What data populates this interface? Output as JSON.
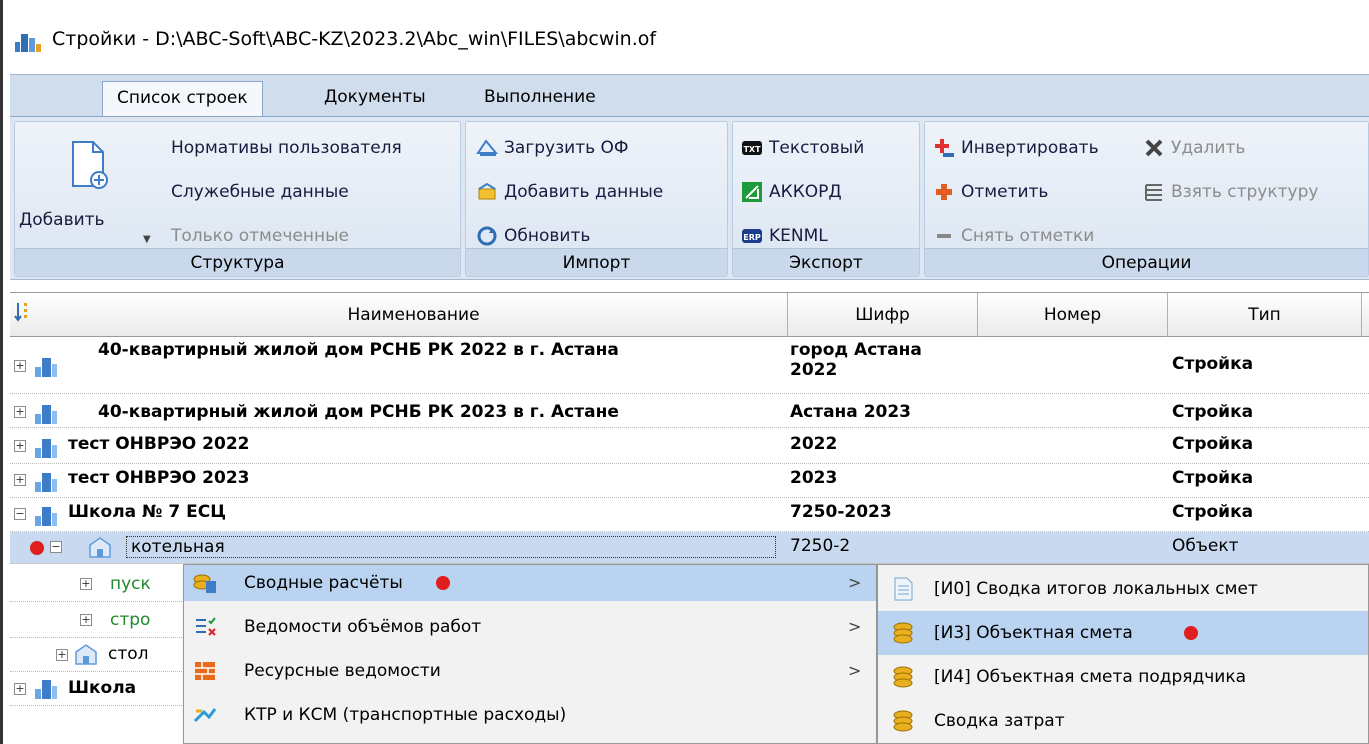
{
  "window": {
    "title": "Стройки - D:\\ABC-Soft\\ABC-KZ\\2023.2\\Abc_win\\FILES\\abcwin.of"
  },
  "ribbon": {
    "tabs": [
      {
        "label": "Список строек",
        "active": true
      },
      {
        "label": "Документы",
        "active": false
      },
      {
        "label": "Выполнение",
        "active": false
      }
    ],
    "groups": {
      "structure": {
        "label": "Структура",
        "add": "Добавить",
        "items": [
          "Нормативы пользователя",
          "Служебные данные",
          "Только отмеченные"
        ]
      },
      "import": {
        "label": "Импорт",
        "items": [
          "Загрузить ОФ",
          "Добавить данные",
          "Обновить"
        ]
      },
      "export": {
        "label": "Экспорт",
        "items": [
          "Текстовый",
          "АККОРД",
          "KENML"
        ]
      },
      "operations": {
        "label": "Операции",
        "items": [
          "Инвертировать",
          "Удалить",
          "Отметить",
          "Взять структуру",
          "Снять отметки"
        ]
      }
    }
  },
  "grid": {
    "columns": [
      "Наименование",
      "Шифр",
      "Номер",
      "Тип"
    ],
    "rows": [
      {
        "name": "40-квартирный жилой дом РСНБ РК 2022 в г. Астана",
        "code1": "город Астана",
        "code2": "2022",
        "type": "Стройка"
      },
      {
        "name": "40-квартирный жилой дом РСНБ РК 2023 в г. Астане",
        "code": "Астана 2023",
        "type": "Стройка"
      },
      {
        "name": "тест ОНВРЭО 2022",
        "code": "2022",
        "type": "Стройка"
      },
      {
        "name": "тест ОНВРЭО 2023",
        "code": "2023",
        "type": "Стройка"
      },
      {
        "name": "Школа № 7 ЕСЦ",
        "code": "7250-2023",
        "type": "Стройка"
      },
      {
        "name": "котельная",
        "code": "7250-2",
        "type": "Объект"
      },
      {
        "name": "пуск"
      },
      {
        "name": "стро"
      },
      {
        "name": "стол"
      },
      {
        "name": "Школа"
      }
    ]
  },
  "context_menu": {
    "items": [
      {
        "label": "Сводные расчёты",
        "submenu": true
      },
      {
        "label": "Ведомости объёмов работ",
        "submenu": true
      },
      {
        "label": "Ресурсные ведомости",
        "submenu": true
      },
      {
        "label": "КТР и КСМ (транспортные расходы)",
        "submenu": false
      }
    ]
  },
  "submenu": {
    "items": [
      {
        "label": "[И0] Сводка итогов локальных смет"
      },
      {
        "label": "[И3] Объектная смета"
      },
      {
        "label": "[И4] Объектная смета подрядчика"
      },
      {
        "label": "Сводка затрат"
      }
    ]
  },
  "colors": {
    "marker": "#e01e1e",
    "highlight": "#b9d3f0",
    "ribbon": "#dde6f1"
  }
}
